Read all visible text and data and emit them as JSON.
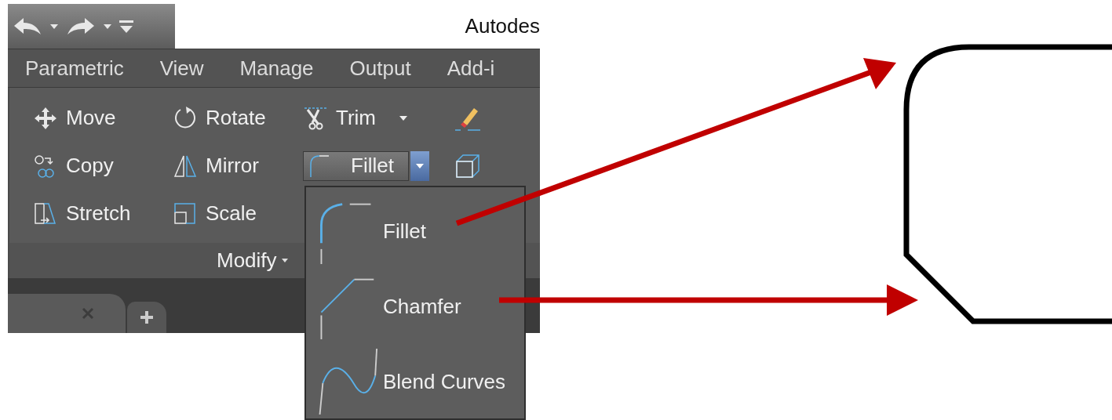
{
  "window": {
    "title": "Autodes"
  },
  "tabs": [
    {
      "label": "Parametric"
    },
    {
      "label": "View"
    },
    {
      "label": "Manage"
    },
    {
      "label": "Output"
    },
    {
      "label": "Add-i"
    }
  ],
  "tools": [
    {
      "label": "Move",
      "kind": "button"
    },
    {
      "label": "Rotate",
      "kind": "button"
    },
    {
      "label": "Trim",
      "kind": "dropdown"
    },
    {
      "label": "Copy",
      "kind": "button"
    },
    {
      "label": "Mirror",
      "kind": "button"
    },
    {
      "label": "Fillet",
      "kind": "split",
      "expanded": true
    },
    {
      "label": "Stretch",
      "kind": "button"
    },
    {
      "label": "Scale",
      "kind": "button"
    }
  ],
  "panel": {
    "title": "Modify"
  },
  "menu": [
    {
      "label": "Fillet"
    },
    {
      "label": "Chamfer"
    },
    {
      "label": "Blend Curves"
    }
  ]
}
